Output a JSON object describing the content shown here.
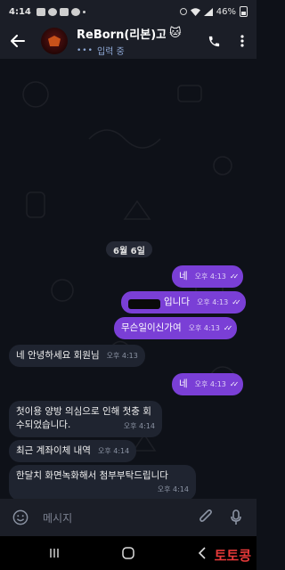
{
  "status": {
    "time": "4:14",
    "battery": "46%"
  },
  "header": {
    "title": "ReBorn(리본)고",
    "title_emoji": "🐱",
    "typing_status": "입력 중"
  },
  "chat": {
    "date": "6월 6일",
    "messages": [
      {
        "dir": "out",
        "text": "네",
        "time": "오후 4:13",
        "read": true
      },
      {
        "dir": "out",
        "text": "입니다",
        "time": "오후 4:13",
        "read": true,
        "redacted_prefix": true
      },
      {
        "dir": "out",
        "text": "무슨일이신가여",
        "time": "오후 4:13",
        "read": true
      },
      {
        "dir": "in",
        "text": "네 안녕하세요 회원님",
        "time": "오후 4:13"
      },
      {
        "dir": "out",
        "text": "네",
        "time": "오후 4:13",
        "read": true
      },
      {
        "dir": "in",
        "text": "첫이용 양방 의심으로 인해 첫충 회수되었습니다.",
        "time": "오후 4:14"
      },
      {
        "dir": "in",
        "text": "최근 계좌이체 내역",
        "time": "오후 4:14"
      },
      {
        "dir": "in",
        "text": "한달치 화면녹화해서 첨부부탁드립니다",
        "time": "오후 4:14"
      }
    ]
  },
  "input": {
    "placeholder": "메시지"
  },
  "watermark": "토토콩"
}
